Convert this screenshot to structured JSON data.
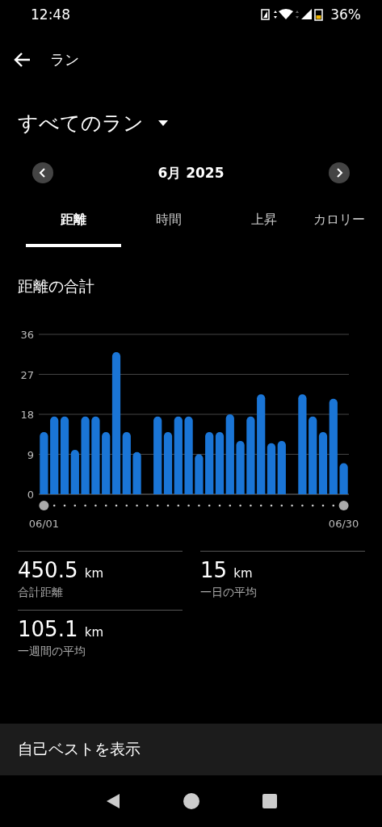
{
  "status_bar": {
    "time": "12:48",
    "battery": "36%"
  },
  "header": {
    "title": "ラン"
  },
  "filter": {
    "label": "すべてのラン"
  },
  "month_nav": {
    "label": "6月 2025"
  },
  "tabs": [
    {
      "label": "距離",
      "selected": true
    },
    {
      "label": "時間",
      "selected": false
    },
    {
      "label": "上昇",
      "selected": false
    },
    {
      "label": "カロリー",
      "selected": false
    }
  ],
  "chart_section": {
    "title": "距離の合計",
    "chart_data": {
      "type": "bar",
      "categories": [
        "06/01",
        null,
        null,
        null,
        null,
        null,
        null,
        null,
        null,
        null,
        null,
        null,
        null,
        null,
        null,
        null,
        null,
        null,
        null,
        null,
        null,
        null,
        null,
        null,
        null,
        null,
        null,
        null,
        null,
        "06/30"
      ],
      "grid": true,
      "series": [
        {
          "color": "#1a75d6",
          "values": [
            14,
            17.5,
            17.5,
            10,
            17.5,
            17.5,
            14,
            32,
            14,
            9.5,
            0,
            17.5,
            14,
            17.5,
            17.5,
            9,
            14,
            14,
            18,
            12,
            17.5,
            22.5,
            11.5,
            12,
            0,
            22.5,
            17.5,
            14,
            21.5,
            7
          ]
        }
      ],
      "ylim": [
        0,
        36
      ],
      "yticks": [
        0,
        9,
        18,
        27,
        36
      ]
    }
  },
  "stats": [
    {
      "value": "450.5",
      "unit": "km",
      "label": "合計距離"
    },
    {
      "value": "15",
      "unit": "km",
      "label": "一日の平均"
    },
    {
      "value": "105.1",
      "unit": "km",
      "label": "一週間の平均"
    }
  ],
  "footer_button": {
    "label": "自己ベストを表示"
  }
}
